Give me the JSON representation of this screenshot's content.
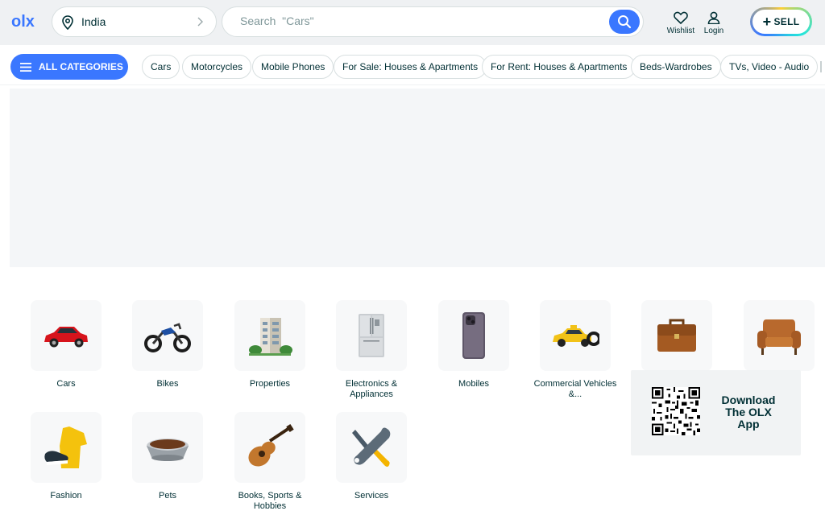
{
  "header": {
    "logo": "olx",
    "location": "India",
    "search_placeholder": "Search  \"Cars\"",
    "wishlist_label": "Wishlist",
    "login_label": "Login",
    "sell_label": "SELL",
    "brand_color": "#3a77ff"
  },
  "catbar": {
    "all_categories_label": "ALL CATEGORIES",
    "chips": [
      "Cars",
      "Motorcycles",
      "Mobile Phones",
      "For Sale: Houses & Apartments",
      "For Rent: Houses & Apartments",
      "Beds-Wardrobes",
      "TVs, Video - Audio"
    ]
  },
  "categories": [
    {
      "label": "Cars",
      "icon": "car-icon"
    },
    {
      "label": "Bikes",
      "icon": "motorbike-icon"
    },
    {
      "label": "Properties",
      "icon": "building-icon"
    },
    {
      "label": "Electronics & Appliances",
      "icon": "refrigerator-icon"
    },
    {
      "label": "Mobiles",
      "icon": "smartphone-icon"
    },
    {
      "label": "Commercial Vehicles &...",
      "icon": "taxi-icon"
    },
    {
      "label": "",
      "icon": "briefcase-icon"
    },
    {
      "label": "",
      "icon": "armchair-icon"
    },
    {
      "label": "Fashion",
      "icon": "clothing-icon"
    },
    {
      "label": "Pets",
      "icon": "pet-bowl-icon"
    },
    {
      "label": "Books, Sports & Hobbies",
      "icon": "guitar-icon"
    },
    {
      "label": "Services",
      "icon": "tools-icon"
    }
  ],
  "app_promo": {
    "line1": "Download",
    "line2": "The OLX",
    "line3": "App",
    "icon": "qr-code-icon"
  }
}
